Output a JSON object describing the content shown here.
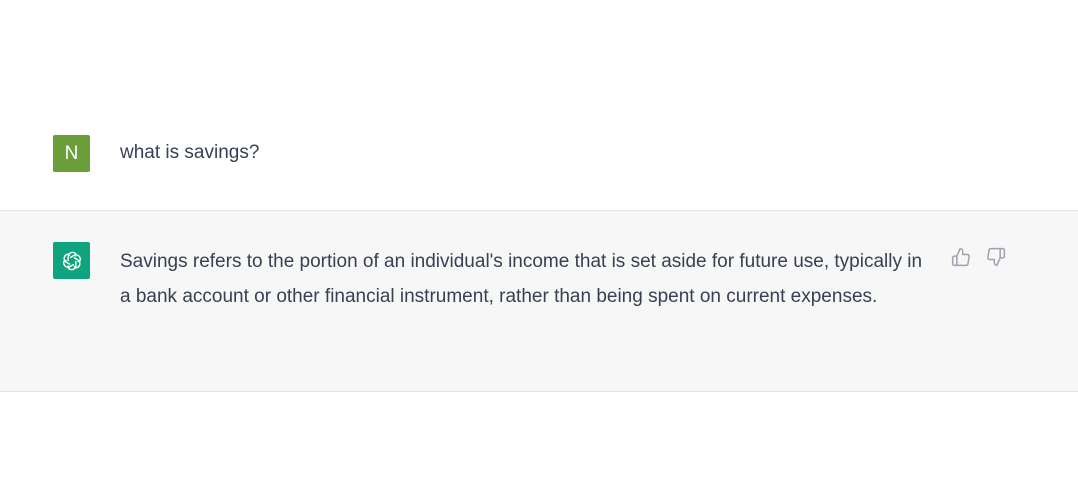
{
  "user_message": {
    "avatar_initial": "N",
    "text": "what is savings?"
  },
  "assistant_message": {
    "avatar_icon": "openai-logo-icon",
    "text": "Savings refers to the portion of an individual's income that is set aside for future use, typically in a bank account or other financial instrument, rather than being spent on current expenses."
  },
  "feedback": {
    "thumbs_up_icon": "thumbs-up-icon",
    "thumbs_down_icon": "thumbs-down-icon"
  },
  "colors": {
    "user_avatar": "#6b9d38",
    "assistant_avatar": "#10a37f",
    "assistant_row_bg": "#f7f7f8",
    "text": "#374151",
    "icon": "#9ca3af"
  }
}
